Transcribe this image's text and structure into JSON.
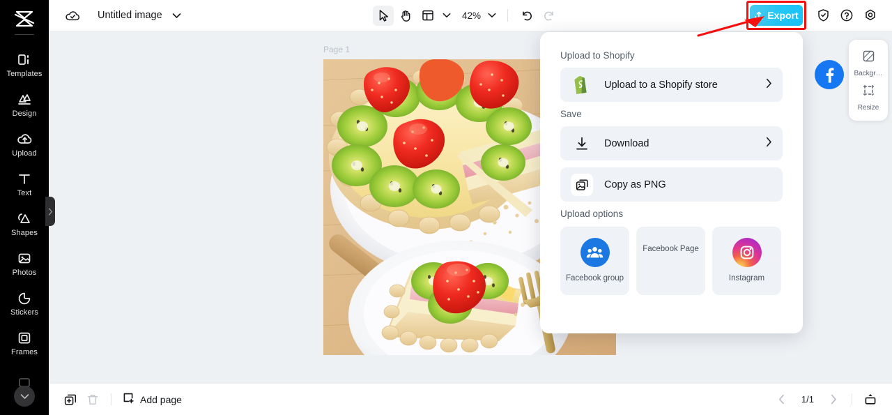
{
  "sidebar": {
    "logo_icon": "capcut-logo-icon",
    "items": [
      {
        "label": "Templates",
        "icon": "templates-icon"
      },
      {
        "label": "Design",
        "icon": "design-icon"
      },
      {
        "label": "Upload",
        "icon": "upload-cloud-icon"
      },
      {
        "label": "Text",
        "icon": "text-icon"
      },
      {
        "label": "Shapes",
        "icon": "shapes-icon"
      },
      {
        "label": "Photos",
        "icon": "photos-icon"
      },
      {
        "label": "Stickers",
        "icon": "stickers-icon"
      },
      {
        "label": "Frames",
        "icon": "frames-icon"
      }
    ],
    "collapse_icon": "chevron-right-icon",
    "more_icon": "chevron-down-icon"
  },
  "topbar": {
    "cloud_icon": "cloud-saved-icon",
    "doc_title": "Untitled image",
    "title_caret_icon": "chevron-down-icon",
    "tools": [
      {
        "name": "select-tool",
        "icon": "cursor-arrow-icon",
        "active": true
      },
      {
        "name": "hand-tool",
        "icon": "hand-icon",
        "active": false
      },
      {
        "name": "layout-tool",
        "icon": "layout-grid-icon",
        "active": false
      }
    ],
    "layout_caret_icon": "chevron-down-icon",
    "zoom_level": "42%",
    "zoom_caret_icon": "chevron-down-icon",
    "undo_icon": "undo-icon",
    "redo_icon": "redo-icon",
    "export_label": "Export",
    "export_icon": "export-upload-icon",
    "export_color": "#22c5f4",
    "highlight_color": "#f5100f",
    "right_icons": [
      {
        "name": "shield-check-icon"
      },
      {
        "name": "help-circle-icon"
      },
      {
        "name": "settings-gear-icon"
      }
    ]
  },
  "canvas": {
    "page_label": "Page 1",
    "image_alt": "fruit-tart-photo"
  },
  "right_panel": {
    "items": [
      {
        "label": "Backgr…",
        "icon": "background-icon"
      },
      {
        "label": "Resize",
        "icon": "resize-icon"
      }
    ]
  },
  "export_menu": {
    "shopify_section": "Upload to Shopify",
    "shopify_row": {
      "label": "Upload to a Shopify store",
      "icon": "shopify-icon",
      "chevron": "chevron-right-icon"
    },
    "save_section": "Save",
    "save_rows": [
      {
        "label": "Download",
        "icon": "download-icon",
        "chevron": "chevron-right-icon"
      },
      {
        "label": "Copy as PNG",
        "icon": "copy-image-icon",
        "chevron": ""
      }
    ],
    "upload_section": "Upload options",
    "tiles": [
      {
        "label": "Facebook group",
        "icon": "facebook-group-icon",
        "color": "#1b78e3"
      },
      {
        "label": "Facebook Page",
        "icon": "facebook-page-icon",
        "color": "#1577f2"
      },
      {
        "label": "Instagram",
        "icon": "instagram-icon",
        "color": "#e4398a"
      }
    ]
  },
  "bottombar": {
    "duplicate_icon": "duplicate-page-icon",
    "delete_icon": "trash-icon",
    "add_page_label": "Add page",
    "add_page_icon": "add-page-icon",
    "prev_icon": "chevron-left-icon",
    "page_indicator": "1/1",
    "next_icon": "chevron-right-icon",
    "present_icon": "present-icon"
  }
}
